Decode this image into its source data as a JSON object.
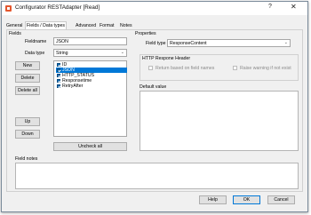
{
  "window": {
    "title": "Configurator RESTAdapter [Read]",
    "help_glyph": "?",
    "close_glyph": "✕"
  },
  "tabs": [
    "General",
    "Fields / Data types",
    "Advanced",
    "Format",
    "Notes"
  ],
  "fields": {
    "section_label": "Fields",
    "fieldname_label": "Fieldname",
    "fieldname_value": "JSON",
    "datatype_label": "Data type",
    "datatype_value": "String",
    "buttons": {
      "new": "New",
      "delete": "Delete",
      "delete_all": "Delete all",
      "up": "Up",
      "down": "Down",
      "uncheck_all": "Uncheck all"
    },
    "list": [
      {
        "name": "ID",
        "checked": true,
        "selected": false
      },
      {
        "name": "JSON",
        "checked": true,
        "selected": true
      },
      {
        "name": "HTTP_STATUS",
        "checked": true,
        "selected": false
      },
      {
        "name": "Responsetime",
        "checked": true,
        "selected": false
      },
      {
        "name": "RetryAfter",
        "checked": true,
        "selected": false
      }
    ]
  },
  "properties": {
    "section_label": "Properties",
    "fieldtype_label": "Field type",
    "fieldtype_value": "ResponseContent",
    "http_header_group": "HTTP Respone Header",
    "return_based_label": "Return based on field names",
    "raise_warning_label": "Raise warning if not exist",
    "default_value_label": "Default value"
  },
  "field_notes": {
    "label": "Field notes"
  },
  "footer": {
    "help": "Help",
    "ok": "OK",
    "cancel": "Cancel"
  },
  "colors": {
    "selection": "#0078d7",
    "checkbox": "#0a64ad",
    "app_icon": "#e4572e"
  },
  "icons": {
    "app": "app-icon",
    "dropdown": "chevron-down-icon"
  }
}
